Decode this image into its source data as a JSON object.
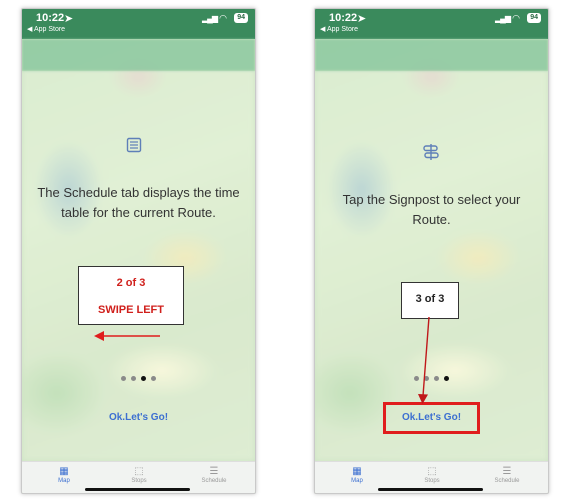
{
  "screens": [
    {
      "status": {
        "time": "10:22",
        "back_label": "◀ App Store",
        "battery": "94"
      },
      "icon": "schedule-list-icon",
      "message": "The Schedule tab displays the time table for the current Route.",
      "cta_label": "Ok.Let's Go!",
      "page_indicator": {
        "total": 4,
        "active": 3
      },
      "tabs": [
        {
          "label": "Map",
          "icon": "map-icon",
          "active": true
        },
        {
          "label": "Stops",
          "icon": "stops-icon",
          "active": false
        },
        {
          "label": "Schedule",
          "icon": "schedule-icon",
          "active": false
        }
      ]
    },
    {
      "status": {
        "time": "10:22",
        "back_label": "◀ App Store",
        "battery": "94"
      },
      "icon": "signpost-icon",
      "message": "Tap the Signpost to select your Route.",
      "cta_label": "Ok.Let's Go!",
      "page_indicator": {
        "total": 4,
        "active": 4
      },
      "tabs": [
        {
          "label": "Map",
          "icon": "map-icon",
          "active": true
        },
        {
          "label": "Stops",
          "icon": "stops-icon",
          "active": false
        },
        {
          "label": "Schedule",
          "icon": "schedule-icon",
          "active": false
        }
      ]
    }
  ],
  "annotations": {
    "callout_a": {
      "step": "2 of 3",
      "hint": "SWIPE LEFT"
    },
    "callout_b": {
      "step": "3 of 3"
    },
    "color": "#e01d1d"
  }
}
